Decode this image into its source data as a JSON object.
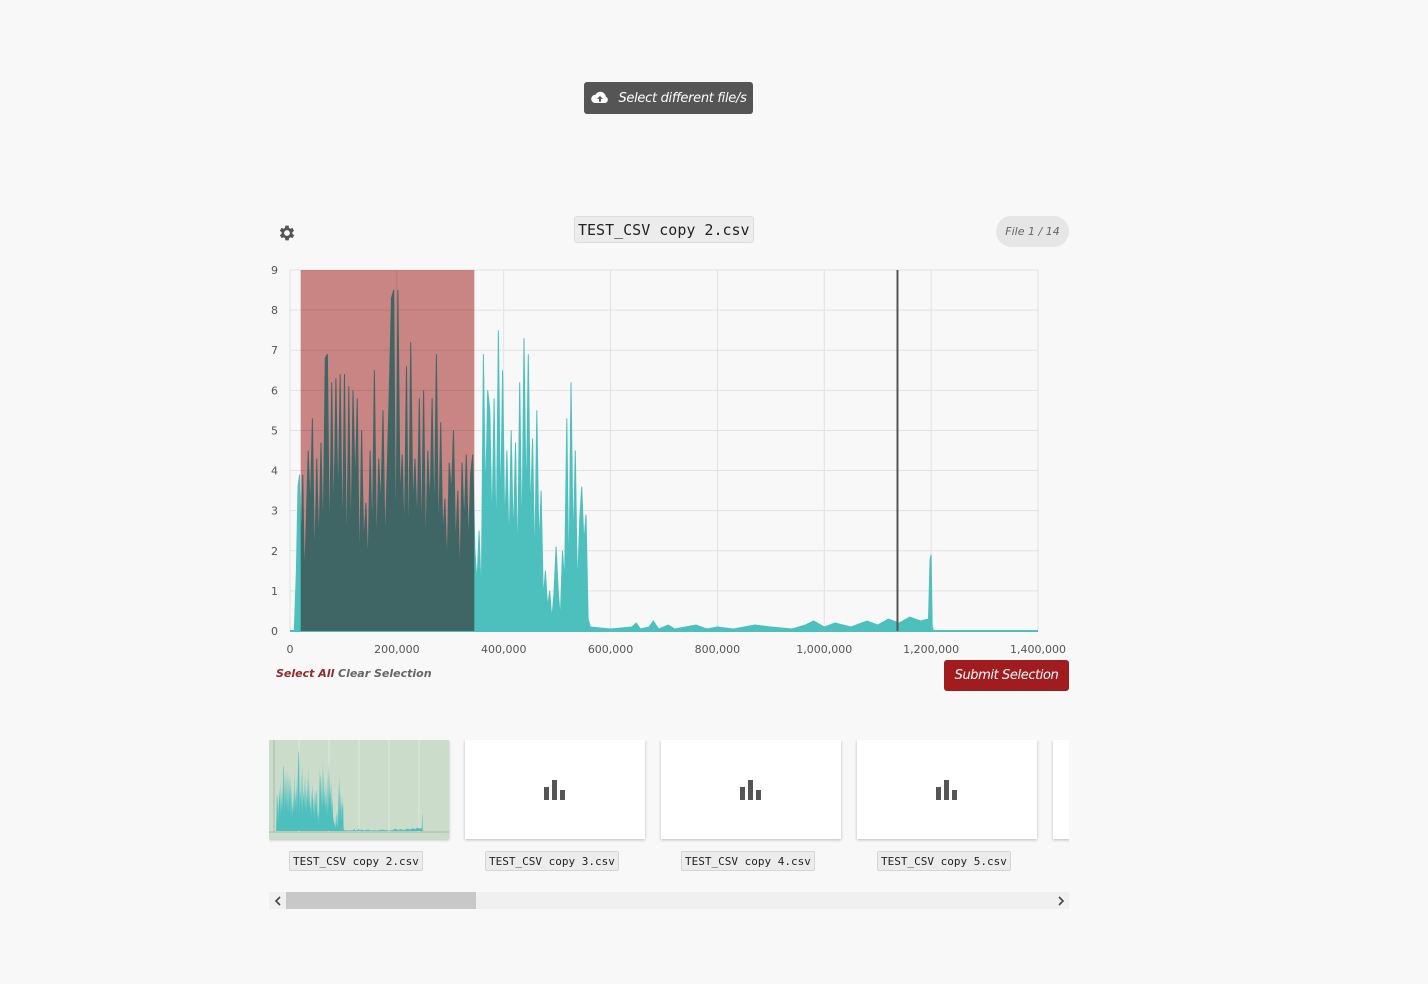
{
  "upload": {
    "label": "Select different file/s",
    "icon": "cloud-upload-icon"
  },
  "viewer": {
    "title": "TEST_CSV copy 2.csv",
    "counter": "File 1 / 14",
    "settings_icon": "gear-icon"
  },
  "chart_data": {
    "type": "area",
    "series_color": "#4dc0be",
    "selection_color": "#c36a6a",
    "xlim": [
      0,
      1400000
    ],
    "ylim": [
      0,
      9
    ],
    "x_ticks": [
      "0",
      "200,000",
      "400,000",
      "600,000",
      "800,000",
      "1,000,000",
      "1,200,000",
      "1,400,000"
    ],
    "y_ticks": [
      "0",
      "1",
      "2",
      "3",
      "4",
      "5",
      "6",
      "7",
      "8",
      "9"
    ],
    "selection_range": [
      20000,
      345000
    ],
    "marker_x": 1137000,
    "grid": true,
    "points": [
      [
        0,
        0
      ],
      [
        8000,
        0
      ],
      [
        12000,
        1.5
      ],
      [
        15000,
        3.6
      ],
      [
        18000,
        3.9
      ],
      [
        21000,
        2.0
      ],
      [
        24000,
        3.9
      ],
      [
        27000,
        1.2
      ],
      [
        30000,
        2.5
      ],
      [
        34000,
        4.5
      ],
      [
        38000,
        3.0
      ],
      [
        42000,
        5.3
      ],
      [
        46000,
        1.5
      ],
      [
        50000,
        4.3
      ],
      [
        54000,
        2.0
      ],
      [
        58000,
        4.7
      ],
      [
        62000,
        2.2
      ],
      [
        66000,
        6.8
      ],
      [
        70000,
        6.9
      ],
      [
        74000,
        1.8
      ],
      [
        78000,
        6.2
      ],
      [
        82000,
        2.5
      ],
      [
        86000,
        6.3
      ],
      [
        90000,
        3.0
      ],
      [
        94000,
        6.4
      ],
      [
        98000,
        2.0
      ],
      [
        102000,
        6.4
      ],
      [
        106000,
        1.5
      ],
      [
        110000,
        6.1
      ],
      [
        114000,
        2.0
      ],
      [
        118000,
        6.0
      ],
      [
        122000,
        3.5
      ],
      [
        126000,
        5.8
      ],
      [
        130000,
        1.2
      ],
      [
        134000,
        5.0
      ],
      [
        138000,
        2.1
      ],
      [
        142000,
        3.2
      ],
      [
        146000,
        1.5
      ],
      [
        150000,
        4.5
      ],
      [
        154000,
        2.2
      ],
      [
        158000,
        6.5
      ],
      [
        162000,
        1.8
      ],
      [
        166000,
        4.3
      ],
      [
        170000,
        3.0
      ],
      [
        174000,
        5.5
      ],
      [
        178000,
        2.0
      ],
      [
        182000,
        4.0
      ],
      [
        186000,
        6.1
      ],
      [
        190000,
        8.3
      ],
      [
        194000,
        8.5
      ],
      [
        198000,
        1.5
      ],
      [
        202000,
        8.5
      ],
      [
        206000,
        3.2
      ],
      [
        210000,
        4.4
      ],
      [
        214000,
        2.2
      ],
      [
        218000,
        6.6
      ],
      [
        222000,
        1.5
      ],
      [
        226000,
        7.2
      ],
      [
        230000,
        3.0
      ],
      [
        234000,
        4.3
      ],
      [
        238000,
        2.5
      ],
      [
        242000,
        5.8
      ],
      [
        246000,
        2.0
      ],
      [
        250000,
        6.0
      ],
      [
        254000,
        1.8
      ],
      [
        258000,
        4.5
      ],
      [
        262000,
        3.0
      ],
      [
        266000,
        5.8
      ],
      [
        270000,
        2.5
      ],
      [
        274000,
        6.9
      ],
      [
        278000,
        2.0
      ],
      [
        282000,
        5.2
      ],
      [
        286000,
        2.3
      ],
      [
        290000,
        3.3
      ],
      [
        294000,
        1.5
      ],
      [
        298000,
        4.2
      ],
      [
        302000,
        3.4
      ],
      [
        306000,
        5.0
      ],
      [
        310000,
        2.0
      ],
      [
        314000,
        3.5
      ],
      [
        318000,
        1.2
      ],
      [
        322000,
        4.2
      ],
      [
        326000,
        2.6
      ],
      [
        330000,
        4.4
      ],
      [
        334000,
        2.0
      ],
      [
        338000,
        3.9
      ],
      [
        342000,
        4.4
      ],
      [
        346000,
        2.0
      ],
      [
        350000,
        1.2
      ],
      [
        354000,
        2.5
      ],
      [
        358000,
        0.8
      ],
      [
        362000,
        6.9
      ],
      [
        366000,
        3.2
      ],
      [
        370000,
        6.0
      ],
      [
        374000,
        5.5
      ],
      [
        378000,
        2.5
      ],
      [
        382000,
        5.8
      ],
      [
        386000,
        2.0
      ],
      [
        390000,
        7.5
      ],
      [
        394000,
        2.8
      ],
      [
        398000,
        6.5
      ],
      [
        402000,
        2.5
      ],
      [
        406000,
        4.5
      ],
      [
        410000,
        2.0
      ],
      [
        414000,
        5.0
      ],
      [
        418000,
        2.2
      ],
      [
        422000,
        4.7
      ],
      [
        426000,
        1.5
      ],
      [
        430000,
        6.2
      ],
      [
        434000,
        2.0
      ],
      [
        438000,
        7.3
      ],
      [
        442000,
        3.0
      ],
      [
        446000,
        6.9
      ],
      [
        450000,
        2.8
      ],
      [
        454000,
        4.8
      ],
      [
        458000,
        1.5
      ],
      [
        462000,
        5.5
      ],
      [
        466000,
        2.0
      ],
      [
        470000,
        3.5
      ],
      [
        474000,
        0.8
      ],
      [
        478000,
        1.5
      ],
      [
        482000,
        0.6
      ],
      [
        486000,
        1.0
      ],
      [
        490000,
        0.3
      ],
      [
        494000,
        0.9
      ],
      [
        498000,
        2.1
      ],
      [
        502000,
        1.0
      ],
      [
        506000,
        0.3
      ],
      [
        510000,
        2.0
      ],
      [
        514000,
        1.2
      ],
      [
        518000,
        5.3
      ],
      [
        522000,
        1.0
      ],
      [
        526000,
        6.2
      ],
      [
        530000,
        2.0
      ],
      [
        534000,
        4.5
      ],
      [
        538000,
        1.0
      ],
      [
        542000,
        2.7
      ],
      [
        546000,
        3.6
      ],
      [
        550000,
        2.2
      ],
      [
        554000,
        2.9
      ],
      [
        558000,
        0.3
      ],
      [
        562000,
        0.1
      ],
      [
        600000,
        0.05
      ],
      [
        640000,
        0.1
      ],
      [
        648000,
        0.2
      ],
      [
        656000,
        0.05
      ],
      [
        672000,
        0.1
      ],
      [
        680000,
        0.25
      ],
      [
        690000,
        0.05
      ],
      [
        708000,
        0.15
      ],
      [
        720000,
        0.05
      ],
      [
        760000,
        0.15
      ],
      [
        780000,
        0.05
      ],
      [
        800000,
        0.1
      ],
      [
        830000,
        0.05
      ],
      [
        870000,
        0.15
      ],
      [
        900000,
        0.1
      ],
      [
        940000,
        0.05
      ],
      [
        965000,
        0.15
      ],
      [
        980000,
        0.25
      ],
      [
        1000000,
        0.1
      ],
      [
        1020000,
        0.2
      ],
      [
        1050000,
        0.1
      ],
      [
        1080000,
        0.25
      ],
      [
        1100000,
        0.15
      ],
      [
        1120000,
        0.3
      ],
      [
        1140000,
        0.2
      ],
      [
        1160000,
        0.35
      ],
      [
        1180000,
        0.25
      ],
      [
        1195000,
        0.3
      ],
      [
        1198000,
        1.8
      ],
      [
        1200000,
        1.9
      ],
      [
        1202000,
        0.1
      ],
      [
        1205000,
        0
      ]
    ]
  },
  "actions": {
    "select_all": "Select All",
    "clear_selection": "Clear Selection",
    "submit": "Submit Selection"
  },
  "files": [
    {
      "name": "TEST_CSV copy 2.csv",
      "thumbnail": "chart-preview"
    },
    {
      "name": "TEST_CSV copy 3.csv",
      "thumbnail": "bar-chart-icon"
    },
    {
      "name": "TEST_CSV copy 4.csv",
      "thumbnail": "bar-chart-icon"
    },
    {
      "name": "TEST_CSV copy 5.csv",
      "thumbnail": "bar-chart-icon"
    }
  ],
  "scrollbar": {
    "left_icon": "chevron-left-icon",
    "right_icon": "chevron-right-icon"
  }
}
